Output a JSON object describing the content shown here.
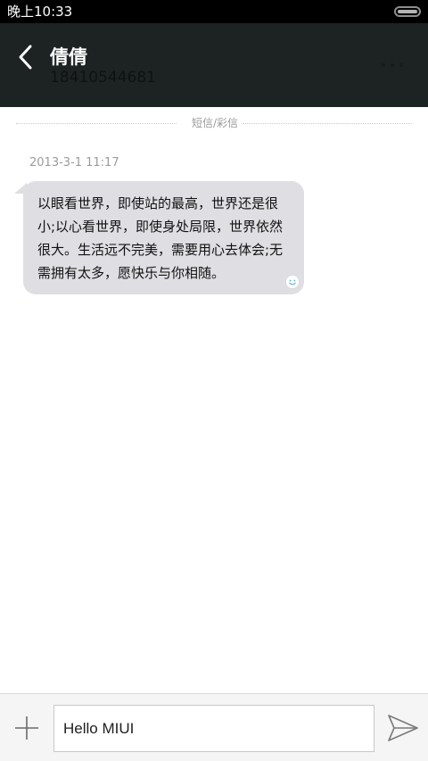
{
  "status_bar": {
    "time": "晚上10:33"
  },
  "header": {
    "contact_name": "倩倩",
    "contact_number": "18410544681"
  },
  "conversation": {
    "message_type_label": "短信/彩信",
    "messages": [
      {
        "timestamp": "2013-3-1 11:17",
        "text": "以眼看世界，即使站的最高，世界还是很小;以心看世界，即使身处局限，世界依然很大。生活远不完美，需要用心去体会;无需拥有太多，愿快乐与你相随。",
        "direction": "incoming"
      }
    ]
  },
  "composer": {
    "input_value": "Hello MIUI"
  },
  "icons": {
    "back": "back-arrow-icon",
    "more": "more-icon",
    "smiley": "smiley-icon",
    "add": "plus-icon",
    "send": "send-icon",
    "battery": "battery-icon"
  },
  "colors": {
    "header_bg": "#1d2322",
    "bubble_bg": "#dfdee3",
    "composer_bg": "#f5f5f5"
  }
}
